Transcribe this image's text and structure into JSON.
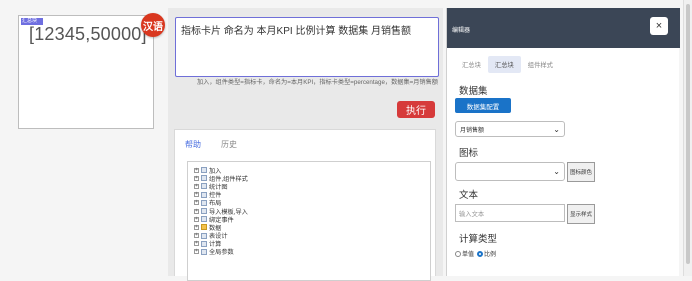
{
  "canvas": {
    "card_tag": "汇总块",
    "card_value": "[12345,50000]"
  },
  "language_badge": "汉语",
  "command": {
    "input_value": "指标卡片 命名为 本月KPI 比例计算 数据集 月销售额",
    "hint": "加入，组件类型=指标卡，命名为=本月KPI，指标卡类型=percentage，数据集=月销售额",
    "run_label": "执行"
  },
  "help": {
    "tabs": [
      "帮助",
      "历史"
    ],
    "active_tab": 0,
    "tree_items": [
      {
        "label": "加入",
        "icon": "doc"
      },
      {
        "label": "组件,组件样式",
        "icon": "doc"
      },
      {
        "label": "统计图",
        "icon": "doc"
      },
      {
        "label": "控件",
        "icon": "doc"
      },
      {
        "label": "布局",
        "icon": "doc"
      },
      {
        "label": "导入模板,导入",
        "icon": "doc"
      },
      {
        "label": "绑定事件",
        "icon": "doc"
      },
      {
        "label": "数据",
        "icon": "folder"
      },
      {
        "label": "表设计",
        "icon": "doc"
      },
      {
        "label": "计算",
        "icon": "doc"
      },
      {
        "label": "全局参数",
        "icon": "doc"
      }
    ]
  },
  "editor": {
    "title": "编辑器",
    "close_label": "×",
    "tabs": [
      "汇总块",
      "汇总块",
      "组件样式"
    ],
    "active_tab": 1,
    "dataset_label": "数据集",
    "dataset_button": "数据集配置",
    "dataset_select": "月销售额",
    "icon_label": "图标",
    "icon_select": "",
    "icon_color_button": "图标颜色",
    "text_label": "文本",
    "text_placeholder": "输入文本",
    "text_style_button": "显示样式",
    "calc_label": "计算类型",
    "calc_options": [
      "单值",
      "比例"
    ],
    "calc_selected": 1
  },
  "colors": {
    "accent_blue": "#1a73c8",
    "run_red": "#d63a3a",
    "badge_red": "#d9371f",
    "header_dark": "#3b4656",
    "input_border": "#6f6fd8"
  }
}
